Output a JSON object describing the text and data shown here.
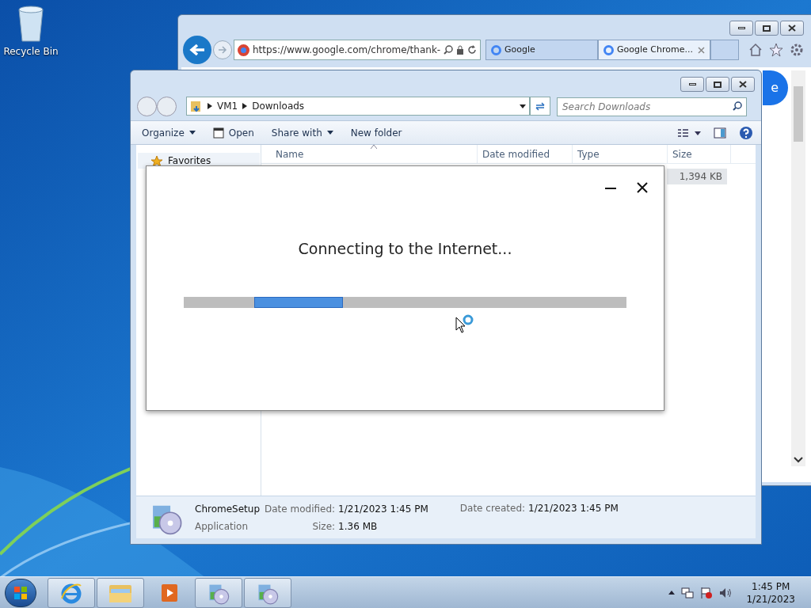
{
  "desktop_icons": [
    {
      "label": "Recycle Bin"
    }
  ],
  "browser": {
    "url": "https://www.google.com/chrome/thank-",
    "tabs": [
      {
        "label": "Google",
        "selected": false
      },
      {
        "label": "Google Chrome...",
        "selected": true
      }
    ],
    "page_button": "e"
  },
  "explorer": {
    "breadcrumb": [
      "VM1",
      "Downloads"
    ],
    "search": {
      "placeholder": "Search Downloads"
    },
    "toolbar": [
      {
        "label": "Organize",
        "kind": "menu"
      },
      {
        "label": "Open",
        "kind": "open"
      },
      {
        "label": "Share with",
        "kind": "menu"
      },
      {
        "label": "New folder",
        "kind": "plain"
      }
    ],
    "nav": [
      {
        "label": "Favorites"
      }
    ],
    "columns": [
      "Name",
      "Date modified",
      "Type",
      "Size"
    ],
    "rows": [
      {
        "size": "1,394 KB"
      }
    ],
    "details": {
      "name": "ChromeSetup",
      "type": "Application",
      "fields": [
        {
          "label": "Date modified:",
          "value": "1/21/2023 1:45 PM"
        },
        {
          "label": "Size:",
          "value": "1.36 MB"
        },
        {
          "label": "Date created:",
          "value": "1/21/2023 1:45 PM"
        }
      ]
    }
  },
  "installer": {
    "message": "Connecting to the Internet...",
    "progress": {
      "kind": "marquee",
      "level": 0.2
    }
  },
  "taskbar": {
    "buttons": [
      {
        "kind": "ie"
      },
      {
        "kind": "folder"
      },
      {
        "kind": "media"
      },
      {
        "kind": "setup"
      },
      {
        "kind": "setup"
      }
    ],
    "time": "1:45 PM",
    "date": "1/21/2023"
  }
}
